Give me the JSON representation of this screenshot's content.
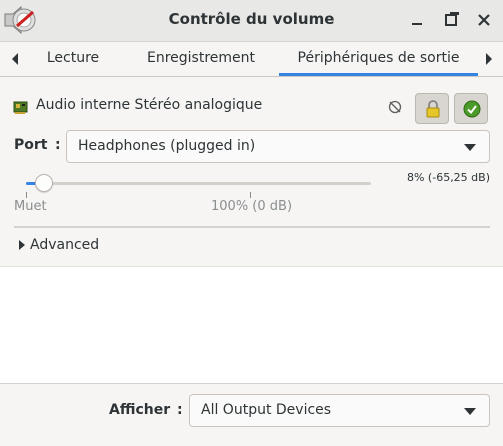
{
  "window": {
    "title": "Contrôle du volume",
    "controls": [
      "minimize-icon",
      "maximize-icon",
      "close-icon"
    ]
  },
  "tabs": {
    "items": [
      {
        "label": "Lecture",
        "active": false
      },
      {
        "label": "Enregistrement",
        "active": false
      },
      {
        "label": "Périphériques de sortie",
        "active": true
      }
    ]
  },
  "device": {
    "name": "Audio interne Stéréo analogique",
    "icons": [
      "sound-card-icon",
      "mute-icon",
      "lock-icon",
      "default-check-icon"
    ]
  },
  "port": {
    "label": "Port",
    "colon": ":",
    "selected": "Headphones (plugged in)"
  },
  "volume": {
    "readout": "8% (-65,25 dB)",
    "level_percent": 8,
    "mark_mute": "Muet",
    "mark_100": "100% (0 dB)"
  },
  "advanced": {
    "label": "Advanced"
  },
  "footer": {
    "label": "Afficher",
    "colon": ":",
    "selected": "All Output Devices"
  },
  "colors": {
    "accent": "#3584e4",
    "window_bg": "#f6f5f4",
    "text": "#2e3436"
  }
}
